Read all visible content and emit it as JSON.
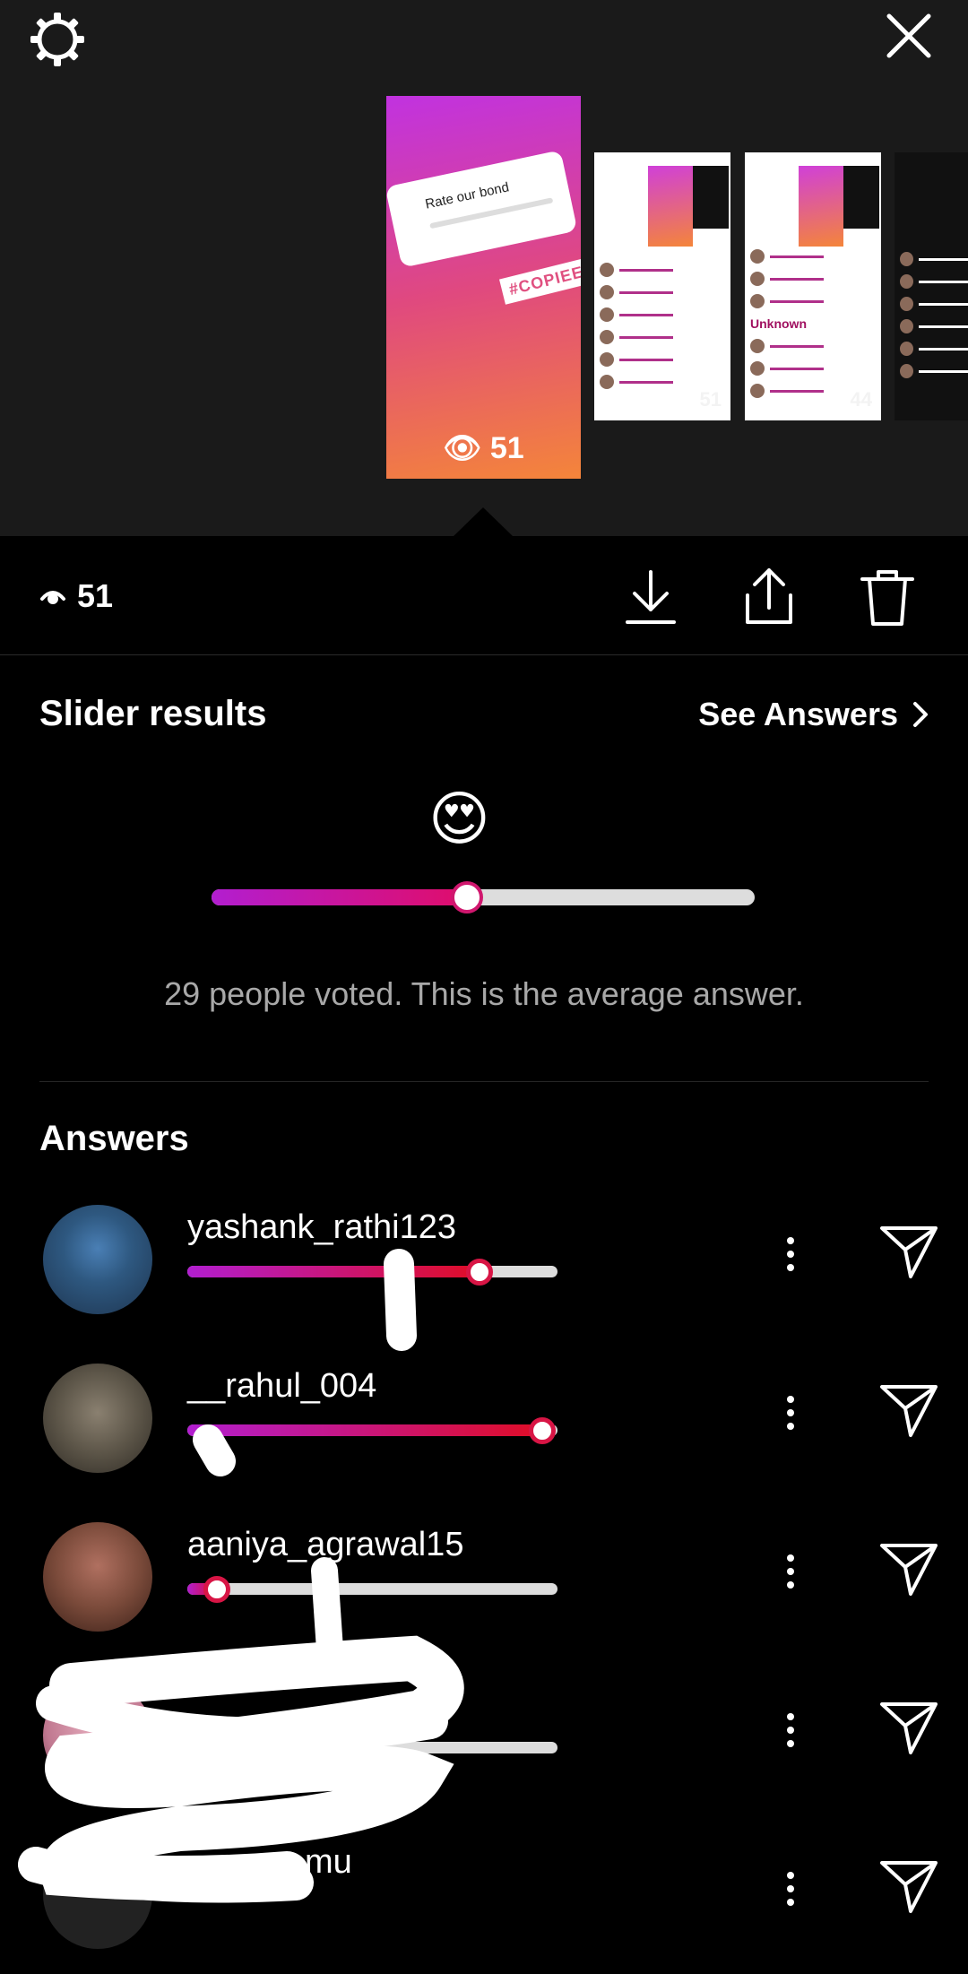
{
  "story": {
    "question": "Rate our bond",
    "tag": "#COPIEE",
    "views": "51",
    "thumb_views": [
      "51",
      "44"
    ],
    "thumb_label": "Unknown"
  },
  "toolbar": {
    "view_count": "51",
    "icons": [
      "download-icon",
      "share-icon",
      "trash-icon"
    ]
  },
  "slider_results": {
    "title": "Slider results",
    "see_answers": "See Answers",
    "emoji": "😍",
    "average_position": 0.47,
    "summary": "29 people voted. This is the average answer."
  },
  "answers": {
    "title": "Answers",
    "items": [
      {
        "username": "yashank_rathi123",
        "value": 0.79
      },
      {
        "username": "__rahul_004",
        "value": 0.96
      },
      {
        "username": "aaniya_agrawal15",
        "value": 0.08
      },
      {
        "username": "",
        "value": 0.0
      },
      {
        "username": "mu",
        "value": 0.0
      }
    ]
  },
  "colors": {
    "accent_start": "#b21ed0",
    "accent_end": "#e00d26",
    "background": "#000000",
    "header_background": "#1a1a1a"
  }
}
